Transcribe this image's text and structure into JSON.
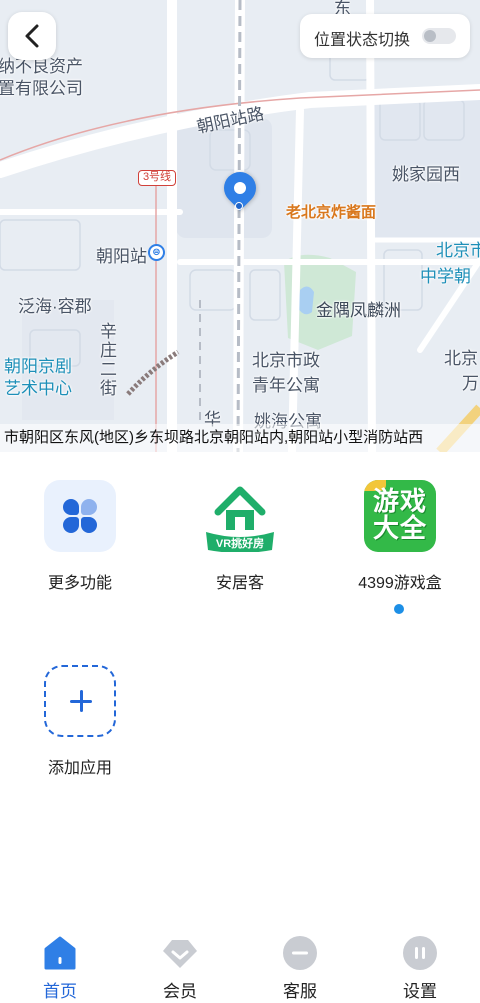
{
  "map": {
    "labels": {
      "company_line1": "纳不良资产",
      "company_line2": "置有限公司",
      "street_road": "朝阳站路",
      "subway_line": "3号线",
      "station": "朝阳站",
      "yaojiayuan": "姚家园西",
      "restaurant": "老北京炸酱面",
      "school_line1": "北京市",
      "school_line2": "中学朝",
      "fanhai": "泛海·容郡",
      "xinzhuang": "辛庄二街",
      "jinyu": "金隅凤麟洲",
      "theater_line1": "朝阳京剧",
      "theater_line2": "艺术中心",
      "apartment_line1": "北京市政",
      "apartment_line2": "青年公寓",
      "yaohai": "姚海公寓",
      "hua": "华",
      "beijing_right": "北京",
      "wan": "万",
      "dong": "东"
    },
    "subway_icon": "subway-icon",
    "address": "市朝阳区东风(地区)乡东坝路北京朝阳站内,朝阳站小型消防站西"
  },
  "toolbar": {
    "back_icon": "chevron-left-icon",
    "toggle_label": "位置状态切换",
    "toggle_on": false
  },
  "apps": [
    {
      "name": "更多功能",
      "icon": "more-functions-icon"
    },
    {
      "name": "安居客",
      "icon": "anjuke-icon",
      "badge": "VR挑好房"
    },
    {
      "name": "4399游戏盒",
      "icon": "game-box-icon",
      "tile_text_1": "游戏",
      "tile_text_2": "大全"
    },
    {
      "name": "添加应用",
      "icon": "plus-icon"
    }
  ],
  "tabs": [
    {
      "label": "首页",
      "icon": "home-icon",
      "active": true
    },
    {
      "label": "会员",
      "icon": "vip-icon",
      "active": false
    },
    {
      "label": "客服",
      "icon": "service-icon",
      "active": false
    },
    {
      "label": "设置",
      "icon": "settings-icon",
      "active": false
    }
  ],
  "colors": {
    "accent": "#2367d8",
    "inactive_icon": "#c9ccd2",
    "map_bg": "#e8edf3",
    "game_green": "#33b948",
    "anjuke_green": "#1fae6a"
  }
}
